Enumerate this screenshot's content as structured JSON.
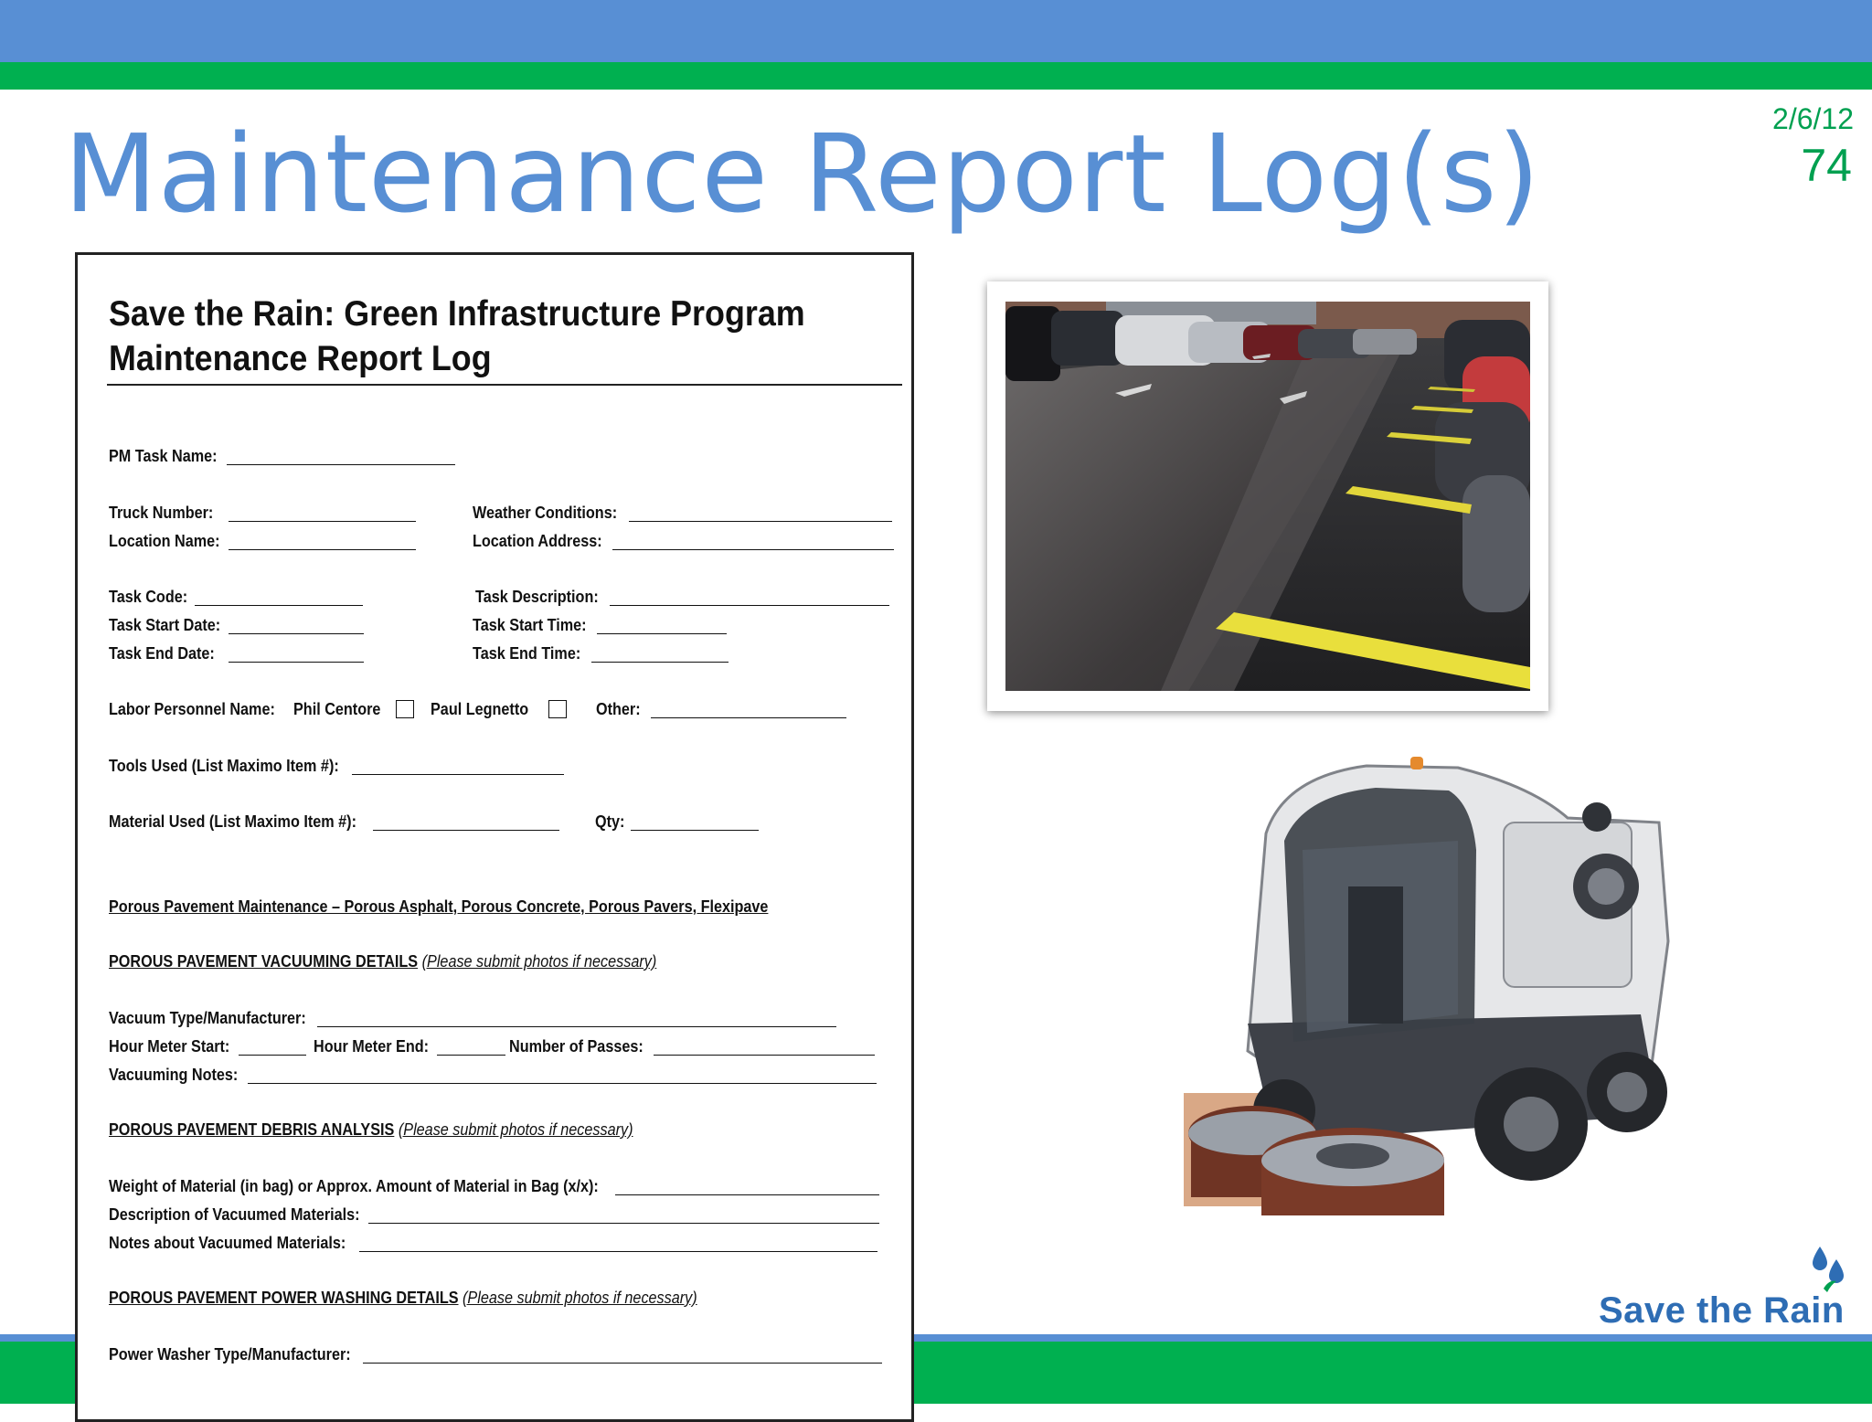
{
  "slide": {
    "title": "Maintenance Report Log(s)",
    "date": "2/6/12",
    "page_number": "74"
  },
  "form": {
    "title_line1": "Save the Rain: Green Infrastructure Program",
    "title_line2": "Maintenance Report Log",
    "pm_task_name": "PM Task Name:",
    "truck_number": "Truck Number:",
    "weather_conditions": "Weather Conditions:",
    "location_name": "Location Name:",
    "location_address": "Location Address:",
    "task_code": "Task Code:",
    "task_description": "Task Description:",
    "task_start_date": "Task Start Date:",
    "task_start_time": "Task Start Time:",
    "task_end_date": "Task End Date:",
    "task_end_time": "Task End Time:",
    "labor_personnel": "Labor Personnel Name:",
    "person_1": "Phil Centore",
    "person_2": "Paul Legnetto",
    "other": "Other:",
    "tools_used": "Tools Used (List Maximo Item #):",
    "material_used": "Material Used (List Maximo Item #):",
    "qty": "Qty:",
    "porous_heading": "Porous Pavement Maintenance – Porous Asphalt, Porous Concrete, Porous Pavers, Flexipave",
    "vacuuming_heading": "POROUS PAVEMENT VACUUMING DETAILS",
    "photos_note": "(Please submit photos if necessary)",
    "vacuum_type": "Vacuum Type/Manufacturer:",
    "hour_meter_start": "Hour Meter Start:",
    "hour_meter_end": "Hour Meter End:",
    "number_of_passes": "Number of Passes:",
    "vacuuming_notes": "Vacuuming Notes:",
    "debris_heading": "POROUS PAVEMENT DEBRIS ANALYSIS",
    "weight_of_material": "Weight of Material (in bag) or Approx. Amount of Material in Bag (x/x):",
    "description_vacuumed": "Description of Vacuumed Materials:",
    "notes_vacuumed": "Notes about Vacuumed Materials:",
    "power_washing_heading": "POROUS PAVEMENT POWER WASHING DETAILS",
    "power_washer_type": "Power Washer Type/Manufacturer:"
  },
  "logo": {
    "text": "Save the Rain"
  },
  "colors": {
    "blue": "#588fd4",
    "green": "#00b050",
    "logo_blue": "#2e6db4"
  }
}
